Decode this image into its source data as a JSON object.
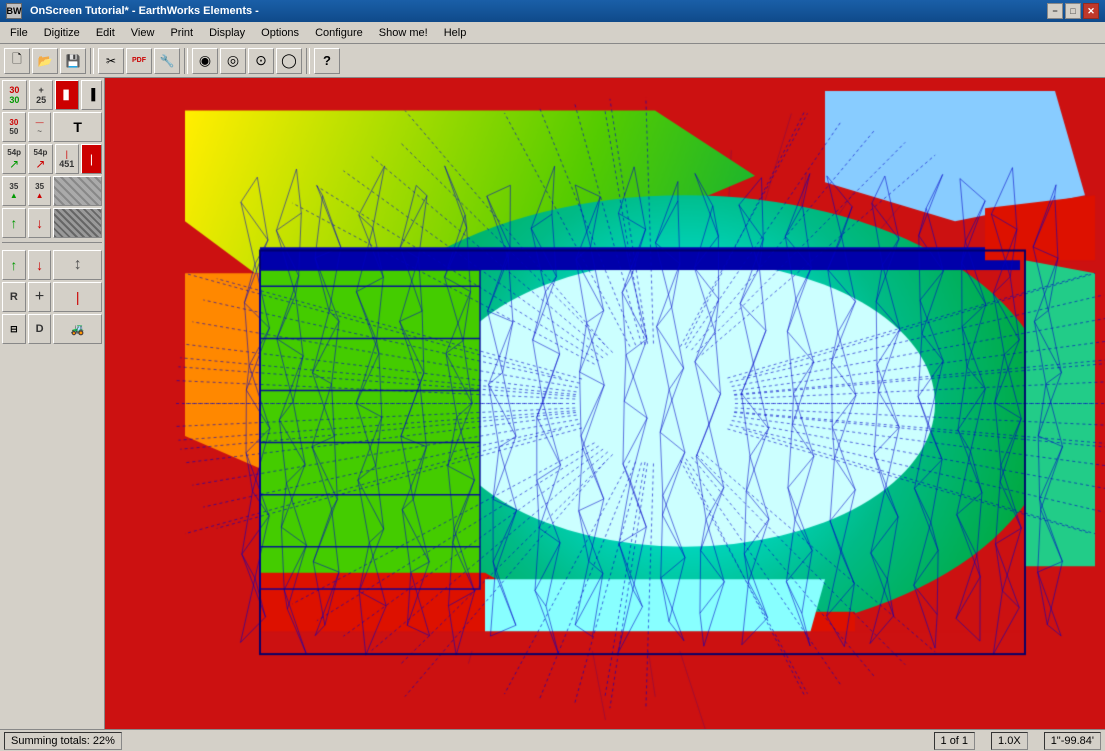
{
  "titlebar": {
    "logo": "BW",
    "title": "OnScreen Tutorial* - EarthWorks Elements -",
    "controls": {
      "minimize": "−",
      "maximize": "□",
      "close": "✕"
    }
  },
  "menubar": {
    "items": [
      "File",
      "Digitize",
      "Edit",
      "View",
      "Print",
      "Display",
      "Options",
      "Configure",
      "Show me!",
      "Help"
    ]
  },
  "toolbar": {
    "buttons": [
      {
        "name": "new",
        "icon": "🗋"
      },
      {
        "name": "open",
        "icon": "📂"
      },
      {
        "name": "save",
        "icon": "💾"
      },
      {
        "name": "cut",
        "icon": "✂"
      },
      {
        "name": "pdf",
        "icon": "PDF"
      },
      {
        "name": "tool1",
        "icon": "⚒"
      },
      {
        "name": "tool2",
        "icon": "◉"
      },
      {
        "name": "tool3",
        "icon": "◎"
      },
      {
        "name": "tool4",
        "icon": "⊙"
      },
      {
        "name": "tool5",
        "icon": "◯"
      },
      {
        "name": "help",
        "icon": "?"
      }
    ]
  },
  "statusbar": {
    "left": "Summing totals: 22%",
    "page": "1 of 1",
    "zoom": "1.0X",
    "coord": "1\"-99.84'"
  },
  "canvas": {
    "description": "EarthWorks triangulated mesh with color-coded elevation map",
    "colors": {
      "red": "#ee1111",
      "yellow": "#ddee00",
      "green": "#22cc00",
      "cyan": "#00cccc",
      "light_cyan": "#88ffff",
      "blue": "#0000dd",
      "orange": "#ff8800",
      "dark_blue": "#003399"
    }
  }
}
